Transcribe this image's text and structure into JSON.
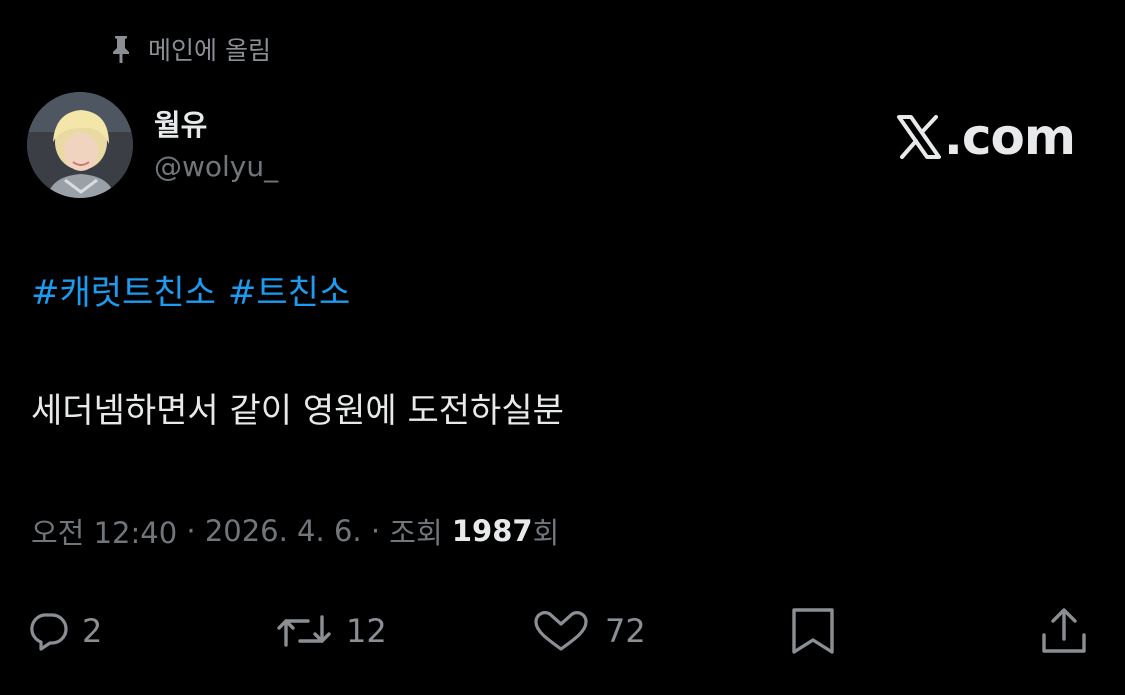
{
  "pinned": {
    "label": "메인에 올림",
    "icon": "pin-icon"
  },
  "user": {
    "name": "월유",
    "handle": "@wolyu_",
    "avatar": "avatar-photo"
  },
  "brand": {
    "logo_icon": "x-logo-icon",
    "text": ".com"
  },
  "post": {
    "hashtags": [
      "#캐럿트친소",
      "#트친소"
    ],
    "text": "세더넴하면서 같이 영원에 도전하실분",
    "hashtag_color": "#1d9bf0"
  },
  "meta": {
    "time": "오전 12:40",
    "separator1": " · ",
    "date": "2026. 4. 6.",
    "separator2": " · ",
    "views_prefix": "조회 ",
    "views_count": "1987",
    "views_suffix": "회"
  },
  "actions": {
    "reply": {
      "icon": "reply-icon",
      "count": "2"
    },
    "repost": {
      "icon": "repost-icon",
      "count": "12"
    },
    "like": {
      "icon": "heart-icon",
      "count": "72"
    },
    "bookmark": {
      "icon": "bookmark-icon"
    },
    "share": {
      "icon": "share-icon"
    }
  },
  "colors": {
    "background": "#000000",
    "text_primary": "#e7e9ea",
    "text_secondary": "#71767b",
    "accent": "#1d9bf0"
  }
}
